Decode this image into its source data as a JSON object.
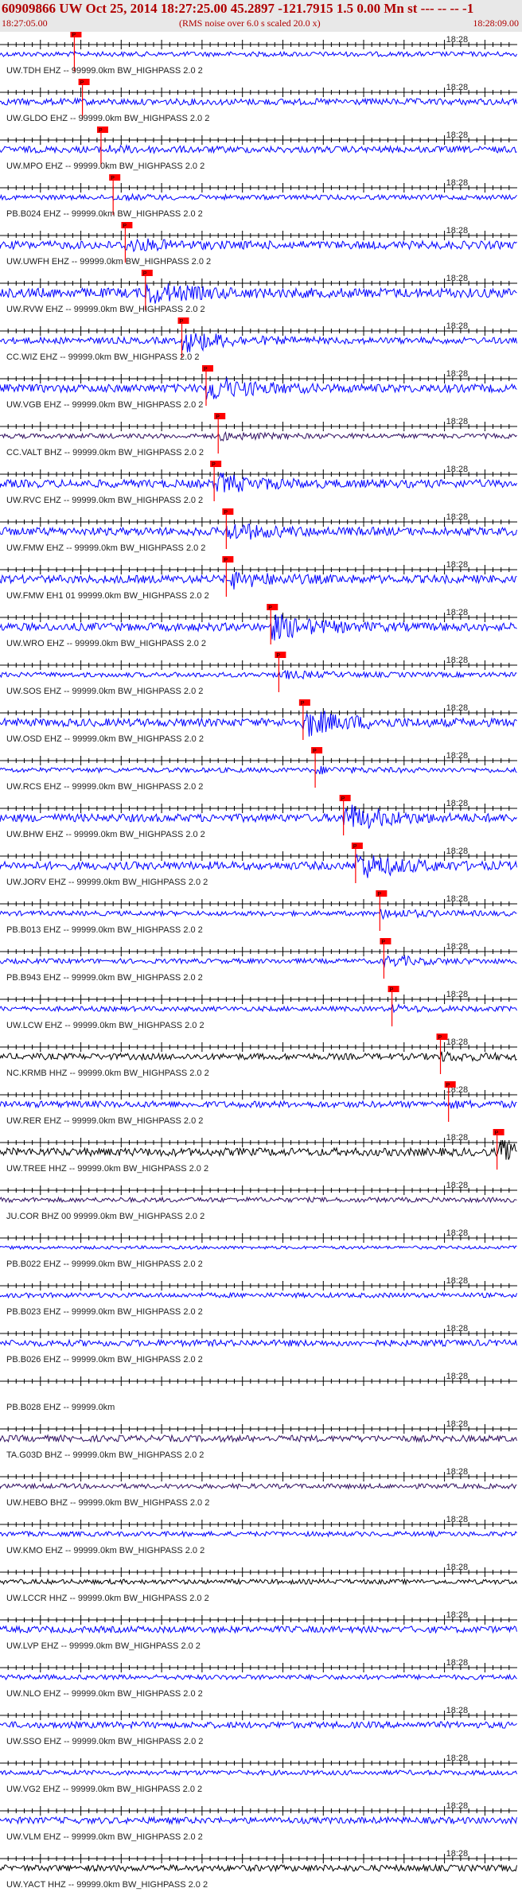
{
  "header": {
    "title": "60909866 UW Oct 25, 2014 18:27:25.00   45.2897 -121.7915  1.5 0.00 Mn st --- -- --  -1",
    "subtitle": "(RMS noise over 6.0 s scaled 20.0 x)",
    "start_time": "18:27:05.00",
    "end_time": "18:28:09.00"
  },
  "chart_data": {
    "type": "seismogram-record",
    "x_start": "18:27:05.00",
    "x_end": "18:28:09.00",
    "tick_label": "18:28",
    "tick_seconds": 55,
    "total_seconds": 64,
    "colors": {
      "trace_blue": "#0000ff",
      "trace_black": "#000000",
      "trace_purple": "#301060",
      "pick": "#ff0000",
      "axis": "#000000"
    },
    "traces": [
      {
        "label": "UW.TDH EHZ -- 99999.0km BW_HIGHPASS  2.0  2",
        "color": "#0000ff",
        "amp": 3,
        "event_s": 9.2,
        "burst": 0,
        "pick_s": 9.2,
        "pick_tag": "P"
      },
      {
        "label": "UW.GLDO EHZ -- 99999.0km BW_HIGHPASS  2.0  2",
        "color": "#0000ff",
        "amp": 4,
        "event_s": 10.2,
        "burst": 0,
        "pick_s": 10.2,
        "pick_tag": "P"
      },
      {
        "label": "UW.MPO EHZ -- 99999.0km BW_HIGHPASS  2.0  2",
        "color": "#0000ff",
        "amp": 4,
        "event_s": 12.5,
        "burst": 3,
        "pick_s": 12.5,
        "pick_tag": "P"
      },
      {
        "label": "PB.B024 EHZ -- 99999.0km BW_HIGHPASS  2.0  2",
        "color": "#0000ff",
        "amp": 3,
        "event_s": 14.0,
        "burst": 2,
        "pick_s": 14.0,
        "pick_tag": "P"
      },
      {
        "label": "UW.UWFH EHZ -- 99999.0km BW_HIGHPASS  2.0  2",
        "color": "#0000ff",
        "amp": 5,
        "event_s": 15.5,
        "burst": 6,
        "pick_s": 15.5,
        "pick_tag": "P"
      },
      {
        "label": "UW.RVW EHZ -- 99999.0km BW_HIGHPASS  2.0  2",
        "color": "#0000ff",
        "amp": 6,
        "event_s": 18.0,
        "burst": 12,
        "pick_s": 18.0,
        "pick_tag": "P"
      },
      {
        "label": "CC.WIZ EHZ -- 99999.0km BW_HIGHPASS  2.0  2",
        "color": "#0000ff",
        "amp": 4,
        "event_s": 22.5,
        "burst": 14,
        "pick_s": 22.5,
        "pick_tag": "P"
      },
      {
        "label": "UW.VGB EHZ -- 99999.0km BW_HIGHPASS  2.0  2",
        "color": "#0000ff",
        "amp": 5,
        "event_s": 25.5,
        "burst": 16,
        "pick_s": 25.5,
        "pick_tag": "P"
      },
      {
        "label": "CC.VALT BHZ -- 99999.0km BW_HIGHPASS  2.0  2",
        "color": "#301060",
        "amp": 3,
        "event_s": 27.0,
        "burst": 4,
        "pick_s": 27.0,
        "pick_tag": "P"
      },
      {
        "label": "UW.RVC EHZ -- 99999.0km BW_HIGHPASS  2.0  2",
        "color": "#0000ff",
        "amp": 5,
        "event_s": 26.5,
        "burst": 12,
        "pick_s": 26.5,
        "pick_tag": "P"
      },
      {
        "label": "UW.FMW EHZ -- 99999.0km BW_HIGHPASS  2.0  2",
        "color": "#0000ff",
        "amp": 5,
        "event_s": 28.0,
        "burst": 10,
        "pick_s": 28.0,
        "pick_tag": "P"
      },
      {
        "label": "UW.FMW EH1 01 99999.0km BW_HIGHPASS  2.0  2",
        "color": "#0000ff",
        "amp": 5,
        "event_s": 28.0,
        "burst": 10,
        "pick_s": 28.0,
        "pick_tag": "P"
      },
      {
        "label": "UW.WRO EHZ -- 99999.0km BW_HIGHPASS  2.0  2",
        "color": "#0000ff",
        "amp": 5,
        "event_s": 33.5,
        "burst": 16,
        "pick_s": 33.5,
        "pick_tag": "P"
      },
      {
        "label": "UW.SOS EHZ -- 99999.0km BW_HIGHPASS  2.0  2",
        "color": "#0000ff",
        "amp": 3,
        "event_s": 34.5,
        "burst": 4,
        "pick_s": 34.5,
        "pick_tag": "P"
      },
      {
        "label": "UW.OSD EHZ -- 99999.0km BW_HIGHPASS  2.0  2",
        "color": "#0000ff",
        "amp": 5,
        "event_s": 37.5,
        "burst": 18,
        "pick_s": 37.5,
        "pick_tag": "P"
      },
      {
        "label": "UW.RCS EHZ -- 99999.0km BW_HIGHPASS  2.0  2",
        "color": "#0000ff",
        "amp": 3,
        "event_s": 39.0,
        "burst": 3,
        "pick_s": 39.0,
        "pick_tag": "P"
      },
      {
        "label": "UW.BHW EHZ -- 99999.0km BW_HIGHPASS  2.0  2",
        "color": "#0000ff",
        "amp": 5,
        "event_s": 42.5,
        "burst": 17,
        "pick_s": 42.5,
        "pick_tag": "P"
      },
      {
        "label": "UW.JORV EHZ -- 99999.0km BW_HIGHPASS  2.0  2",
        "color": "#0000ff",
        "amp": 5,
        "event_s": 44.0,
        "burst": 18,
        "pick_s": 44.0,
        "pick_tag": "P"
      },
      {
        "label": "PB.B013 EHZ -- 99999.0km BW_HIGHPASS  2.0  2",
        "color": "#0000ff",
        "amp": 3,
        "event_s": 47.0,
        "burst": 5,
        "pick_s": 47.0,
        "pick_tag": "P"
      },
      {
        "label": "PB.B943 EHZ -- 99999.0km BW_HIGHPASS  2.0  2",
        "color": "#0000ff",
        "amp": 3,
        "event_s": 47.5,
        "burst": 6,
        "pick_s": 47.5,
        "pick_tag": "P"
      },
      {
        "label": "UW.LCW EHZ -- 99999.0km BW_HIGHPASS  2.0  2",
        "color": "#0000ff",
        "amp": 3,
        "event_s": 48.5,
        "burst": 3,
        "pick_s": 48.5,
        "pick_tag": "P"
      },
      {
        "label": "NC.KRMB HHZ -- 99999.0km BW_HIGHPASS  2.0  2",
        "color": "#000000",
        "amp": 4,
        "event_s": 54.5,
        "burst": 4,
        "pick_s": 54.5,
        "pick_tag": "P"
      },
      {
        "label": "UW.RER EHZ -- 99999.0km BW_HIGHPASS  2.0  2",
        "color": "#0000ff",
        "amp": 4,
        "event_s": 55.5,
        "burst": 2,
        "pick_s": 55.5,
        "pick_tag": "P"
      },
      {
        "label": "UW.TREE HHZ -- 99999.0km BW_HIGHPASS  2.0  2",
        "color": "#000000",
        "amp": 5,
        "event_s": 61.5,
        "burst": 12,
        "pick_s": 61.5,
        "pick_tag": "P"
      },
      {
        "label": "JU.COR BHZ 00 99999.0km BW_HIGHPASS  2.0  2",
        "color": "#301060",
        "amp": 3
      },
      {
        "label": "PB.B022 EHZ -- 99999.0km BW_HIGHPASS  2.0  2",
        "color": "#0000ff",
        "amp": 2
      },
      {
        "label": "PB.B023 EHZ -- 99999.0km BW_HIGHPASS  2.0  2",
        "color": "#0000ff",
        "amp": 3
      },
      {
        "label": "PB.B026 EHZ -- 99999.0km BW_HIGHPASS  2.0  2",
        "color": "#0000ff",
        "amp": 4
      },
      {
        "label": "PB.B028 EHZ -- 99999.0km",
        "color": "#0000ff",
        "amp": 0
      },
      {
        "label": "TA.G03D BHZ -- 99999.0km BW_HIGHPASS  2.0  2",
        "color": "#301060",
        "amp": 4
      },
      {
        "label": "UW.HEBO BHZ -- 99999.0km BW_HIGHPASS  2.0  2",
        "color": "#301060",
        "amp": 3
      },
      {
        "label": "UW.KMO EHZ -- 99999.0km BW_HIGHPASS  2.0  2",
        "color": "#0000ff",
        "amp": 3
      },
      {
        "label": "UW.LCCR HHZ -- 99999.0km BW_HIGHPASS  2.0  2",
        "color": "#000000",
        "amp": 3
      },
      {
        "label": "UW.LVP EHZ -- 99999.0km BW_HIGHPASS  2.0  2",
        "color": "#0000ff",
        "amp": 4
      },
      {
        "label": "UW.NLO EHZ -- 99999.0km BW_HIGHPASS  2.0  2",
        "color": "#0000ff",
        "amp": 3
      },
      {
        "label": "UW.SSO EHZ -- 99999.0km BW_HIGHPASS  2.0  2",
        "color": "#0000ff",
        "amp": 4
      },
      {
        "label": "UW.VG2 EHZ -- 99999.0km BW_HIGHPASS  2.0  2",
        "color": "#0000ff",
        "amp": 3
      },
      {
        "label": "UW.VLM EHZ -- 99999.0km BW_HIGHPASS  2.0  2",
        "color": "#0000ff",
        "amp": 4
      },
      {
        "label": "UW.YACT HHZ -- 99999.0km BW_HIGHPASS  2.0  2",
        "color": "#000000",
        "amp": 4
      }
    ]
  }
}
